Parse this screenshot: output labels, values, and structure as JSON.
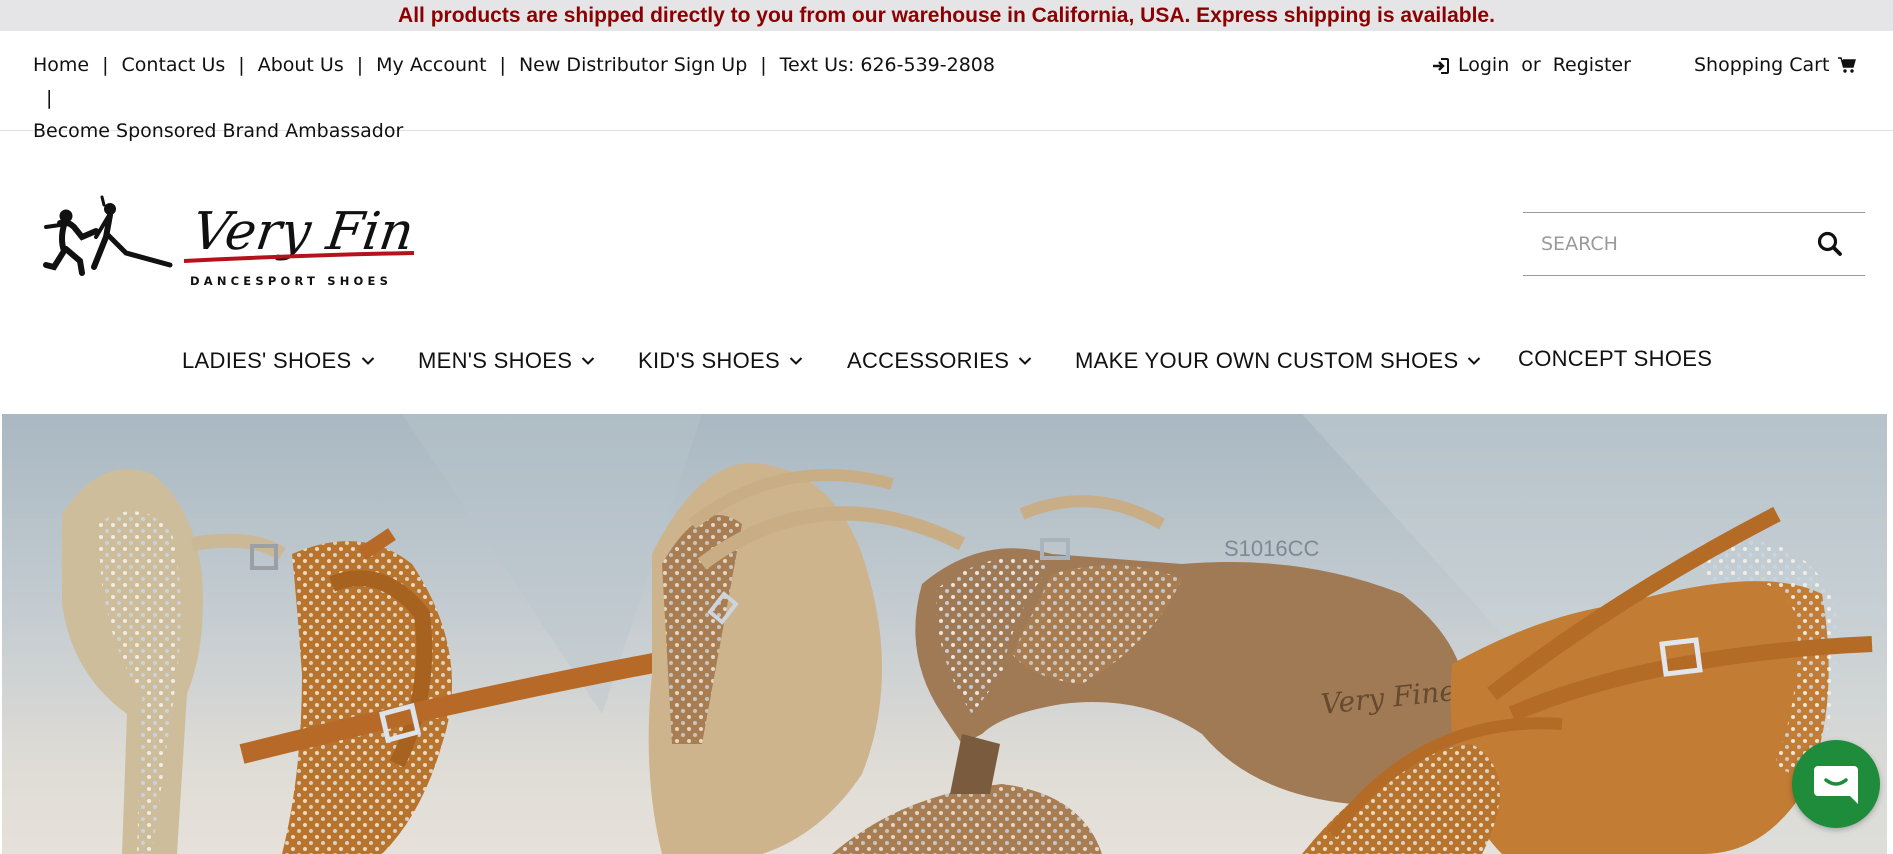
{
  "announcement": "All products are shipped directly to you from our warehouse in California, USA. Express shipping is available.",
  "top_links": {
    "home": "Home",
    "contact": "Contact Us",
    "about": "About Us",
    "account": "My Account",
    "distributor": "New Distributor Sign Up",
    "text_us": "Text Us: 626-539-2808",
    "ambassador": "Become Sponsored Brand Ambassador",
    "separator": "|"
  },
  "auth": {
    "login": "Login",
    "or": "or",
    "register": "Register"
  },
  "cart": {
    "label": "Shopping Cart"
  },
  "logo": {
    "brand": "Very Fine",
    "tagline": "DANCESPORT SHOES"
  },
  "search": {
    "placeholder": "SEARCH"
  },
  "nav": {
    "ladies": "LADIES' SHOES",
    "mens": "MEN'S SHOES",
    "kids": "KID'S SHOES",
    "accessories": "ACCESSORIES",
    "custom": "MAKE YOUR OWN CUSTOM SHOES",
    "concept": "CONCEPT SHOES"
  },
  "hero": {
    "model_code": "S1016CC",
    "sole_brand": "Very Fine"
  },
  "colors": {
    "announcement_text": "#8b0000",
    "chat_button": "#1e8c3a",
    "logo_underline": "#b5121b"
  },
  "icons": {
    "login": "sign-in-icon",
    "cart": "cart-icon",
    "search": "search-icon",
    "chevron": "chevron-down-icon",
    "chat": "chat-icon"
  }
}
